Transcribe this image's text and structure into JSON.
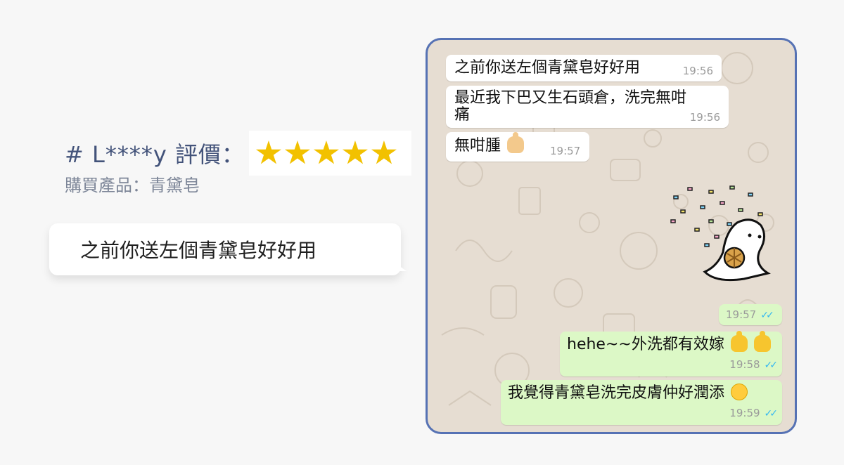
{
  "review": {
    "title": "# L****y 評價：",
    "stars": 5,
    "product": "購買產品：青黛皂",
    "quote": "之前你送左個青黛皂好好用"
  },
  "chat": {
    "messages": [
      {
        "dir": "in",
        "text": "之前你送左個青黛皂好好用",
        "time": "19:56"
      },
      {
        "dir": "in",
        "text": "最近我下巴又生石頭倉，洗完無咁痛",
        "line1": "最近我下巴又生石頭倉，洗完無咁",
        "line2": "痛",
        "time": "19:56"
      },
      {
        "dir": "in",
        "text": "無咁腫",
        "emoji": "thumbs-up-light-icon",
        "time": "19:57"
      },
      {
        "dir": "out",
        "sticker": "cat-confetti-sticker",
        "time": "19:57"
      },
      {
        "dir": "out",
        "text": "hehe~~外洗都有效嫁",
        "emoji": "thumbs-up-icon",
        "time": "19:58"
      },
      {
        "dir": "out",
        "text": "我覺得青黛皂洗完皮膚仲好潤添",
        "emoji": "smiling-face-icon",
        "time": "19:59"
      }
    ]
  },
  "colors": {
    "accent": "#43537a",
    "star": "#f2c100",
    "phone_border": "#5672b4",
    "outgoing_bubble": "#dcf8c6",
    "incoming_bubble": "#ffffff",
    "read_ticks": "#34b7f1"
  }
}
